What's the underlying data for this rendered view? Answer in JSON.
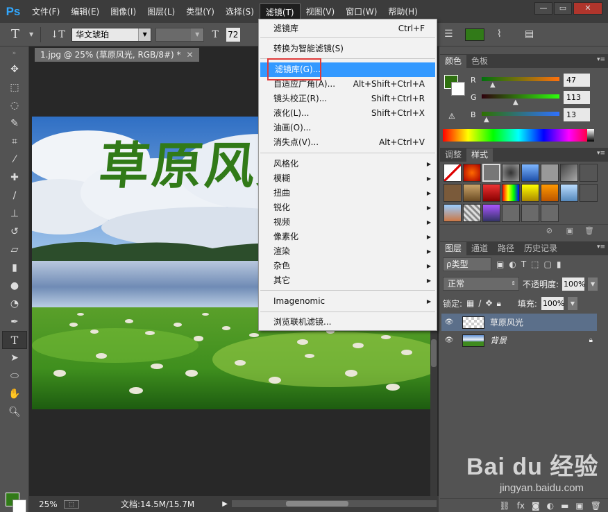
{
  "app": {
    "logo": "Ps"
  },
  "menubar": {
    "items": [
      "文件(F)",
      "编辑(E)",
      "图像(I)",
      "图层(L)",
      "类型(Y)",
      "选择(S)",
      "滤镜(T)",
      "视图(V)",
      "窗口(W)",
      "帮助(H)"
    ],
    "active_index": 6
  },
  "window_buttons": {
    "minimize": "—",
    "restore": "▭",
    "close": "✕"
  },
  "options": {
    "font_family": "华文琥珀",
    "font_size": "72",
    "text_color": "#317a18"
  },
  "document": {
    "tab_title": "1.jpg @ 25% (草原风光, RGB/8#) *",
    "canvas_text": "草原风光",
    "canvas_text_color": "#317a18",
    "zoom": "25%",
    "doc_size": "文档:14.5M/15.7M"
  },
  "filter_menu": {
    "items": [
      {
        "label": "滤镜库",
        "shortcut": "Ctrl+F"
      },
      {
        "label": "转换为智能滤镜(S)",
        "shortcut": ""
      },
      {
        "label": "滤镜库(G)...",
        "shortcut": "",
        "highlighted": true
      },
      {
        "label": "自适应广角(A)...",
        "shortcut": "Alt+Shift+Ctrl+A"
      },
      {
        "label": "镜头校正(R)...",
        "shortcut": "Shift+Ctrl+R"
      },
      {
        "label": "液化(L)...",
        "shortcut": "Shift+Ctrl+X"
      },
      {
        "label": "油画(O)...",
        "shortcut": ""
      },
      {
        "label": "消失点(V)...",
        "shortcut": "Alt+Ctrl+V"
      },
      {
        "label": "风格化",
        "submenu": true
      },
      {
        "label": "模糊",
        "submenu": true
      },
      {
        "label": "扭曲",
        "submenu": true
      },
      {
        "label": "锐化",
        "submenu": true
      },
      {
        "label": "视频",
        "submenu": true
      },
      {
        "label": "像素化",
        "submenu": true
      },
      {
        "label": "渲染",
        "submenu": true
      },
      {
        "label": "杂色",
        "submenu": true
      },
      {
        "label": "其它",
        "submenu": true
      },
      {
        "label": "Imagenomic",
        "submenu": true
      },
      {
        "label": "浏览联机滤镜..."
      }
    ]
  },
  "color_panel": {
    "tabs": [
      "颜色",
      "色板"
    ],
    "r_label": "R",
    "g_label": "G",
    "b_label": "B",
    "r": "47",
    "g": "113",
    "b": "13",
    "fg_color": "#2f710d"
  },
  "styles_panel": {
    "tabs": [
      "调整",
      "样式"
    ]
  },
  "layers_panel": {
    "tabs": [
      "图层",
      "通道",
      "路径",
      "历史记录"
    ],
    "kind": "ρ类型",
    "blend_mode": "正常",
    "opacity_label": "不透明度:",
    "opacity": "100%",
    "lock_label": "锁定:",
    "fill_label": "填充:",
    "fill": "100%",
    "layers": [
      {
        "name": "草原风光",
        "selected": true
      },
      {
        "name": "背景",
        "locked": true
      }
    ]
  },
  "watermark": {
    "brand": "Bai du 经验",
    "url": "jingyan.baidu.com"
  }
}
